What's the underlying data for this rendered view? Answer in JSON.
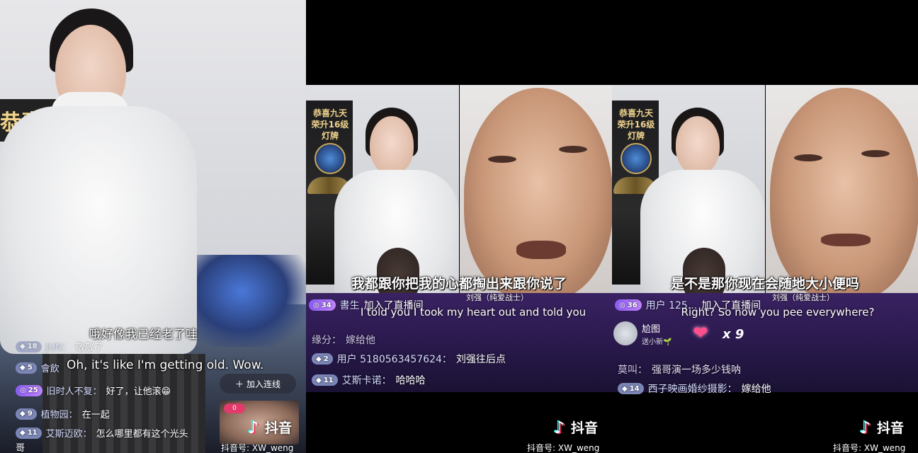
{
  "platform": {
    "logo_text": "抖音",
    "account_id": "抖音号: XW_weng"
  },
  "panel1": {
    "banner_text": "恭喜九",
    "subtitle_cn": "哦好像我已经老了哇",
    "subtitle_en": "Oh, it's like I'm getting old. Wow.",
    "join_button": "加入连线",
    "mini_badge": "0",
    "chat": [
      {
        "level": "18",
        "name": "JUN：",
        "text": "敬敬了"
      },
      {
        "level": "5",
        "name": "會飲",
        "text": ""
      },
      {
        "level": "25",
        "name": "旧时人不复：",
        "text": "好了，让他滚😁"
      },
      {
        "level": "9",
        "name": "植物园：",
        "text": "在一起"
      },
      {
        "level": "11",
        "name": "艾斯迈欧：",
        "text": "怎么哪里都有这个光头"
      },
      {
        "level": "",
        "name": "",
        "text": "哥"
      }
    ]
  },
  "panel2": {
    "poster_text": "恭喜九天\n荣升16级灯牌",
    "subtitle_cn": "我都跟你把我的心都掏出来跟你说了",
    "cam_label": "刘强（纯爱战士）",
    "join_badge": "34",
    "join_name": "書生",
    "join_text": "加入了直播间",
    "subtitle_en": "I told you I took my heart out and told you",
    "chat": [
      {
        "level": "",
        "name": "缘分：",
        "text": "嫁给他"
      },
      {
        "level": "2",
        "name": "用户 5180563457624：",
        "text": "刘强往后点"
      },
      {
        "level": "11",
        "name": "艾斯卡诺：",
        "text": "哈哈哈"
      }
    ]
  },
  "panel3": {
    "poster_text": "恭喜九天\n荣升16级灯牌",
    "subtitle_cn": "是不是那你现在会随地大小便吗",
    "cam_label": "刘强（纯爱战士）",
    "join_badge": "36",
    "join_name": "用户 125...",
    "join_text": "加入了直播间",
    "subtitle_en": "Right? So now you pee everywhere?",
    "gift_name": "尬图",
    "gift_sub": "送小新🌱",
    "gift_count": "x 9",
    "chat": [
      {
        "level": "",
        "name": "莫叫：",
        "text": "强哥演一场多少钱呐"
      },
      {
        "level": "14",
        "name": "西子映画婚纱摄影：",
        "text": "嫁给他"
      }
    ]
  }
}
